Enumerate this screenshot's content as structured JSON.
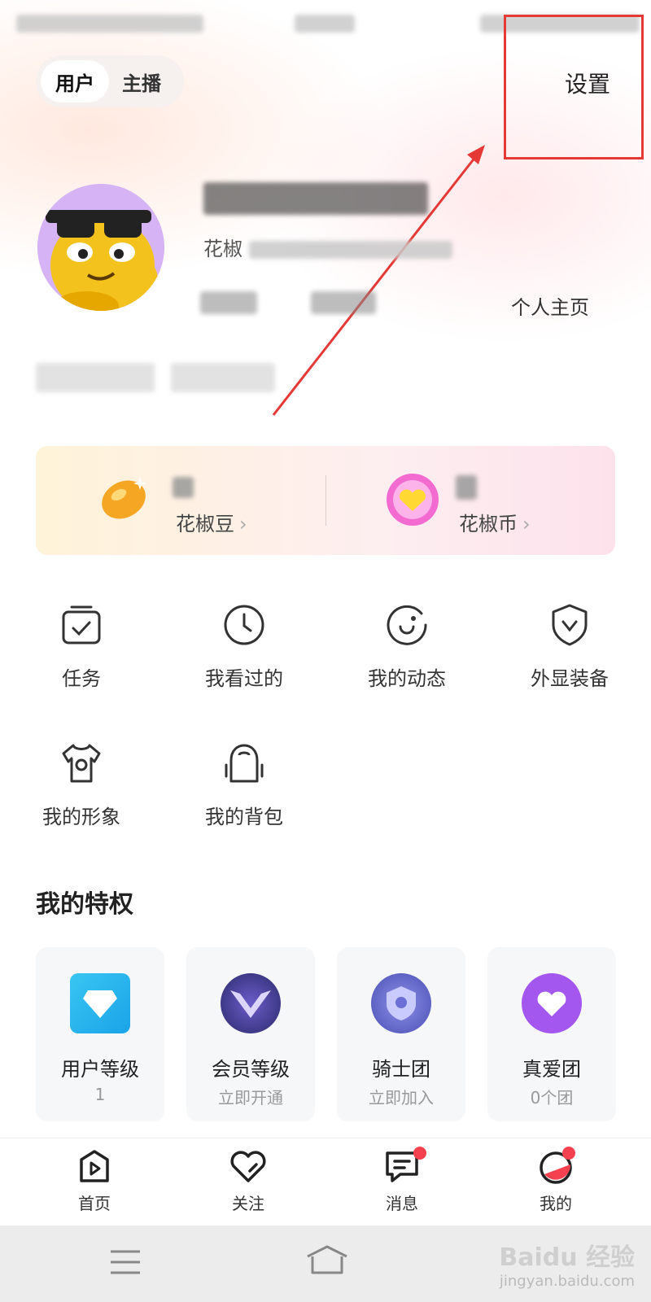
{
  "header": {
    "role_tabs": [
      "用户",
      "主播"
    ],
    "settings_label": "设置"
  },
  "profile": {
    "uid_prefix": "花椒",
    "homepage_label": "个人主页"
  },
  "wallet": {
    "beans_label": "花椒豆",
    "coins_label": "花椒币"
  },
  "quick_actions": [
    {
      "label": "任务",
      "icon": "task-icon"
    },
    {
      "label": "我看过的",
      "icon": "history-clock-icon"
    },
    {
      "label": "我的动态",
      "icon": "moments-icon"
    },
    {
      "label": "外显装备",
      "icon": "shield-icon"
    },
    {
      "label": "我的形象",
      "icon": "tshirt-icon"
    },
    {
      "label": "我的背包",
      "icon": "backpack-icon"
    }
  ],
  "privileges": {
    "title": "我的特权",
    "items": [
      {
        "title": "用户等级",
        "sub": "1",
        "icon": "diamond-icon"
      },
      {
        "title": "会员等级",
        "sub": "立即开通",
        "icon": "vip-wings-icon"
      },
      {
        "title": "骑士团",
        "sub": "立即加入",
        "icon": "knight-shield-icon"
      },
      {
        "title": "真爱团",
        "sub": "0个团",
        "icon": "heart-badge-icon"
      }
    ]
  },
  "bottom_nav": [
    {
      "label": "首页",
      "icon": "play-home-icon"
    },
    {
      "label": "关注",
      "icon": "heart-icon"
    },
    {
      "label": "消息",
      "icon": "message-icon"
    },
    {
      "label": "我的",
      "icon": "me-icon"
    }
  ],
  "watermark": {
    "main": "Baidu 经验",
    "sub": "jingyan.baidu.com"
  }
}
